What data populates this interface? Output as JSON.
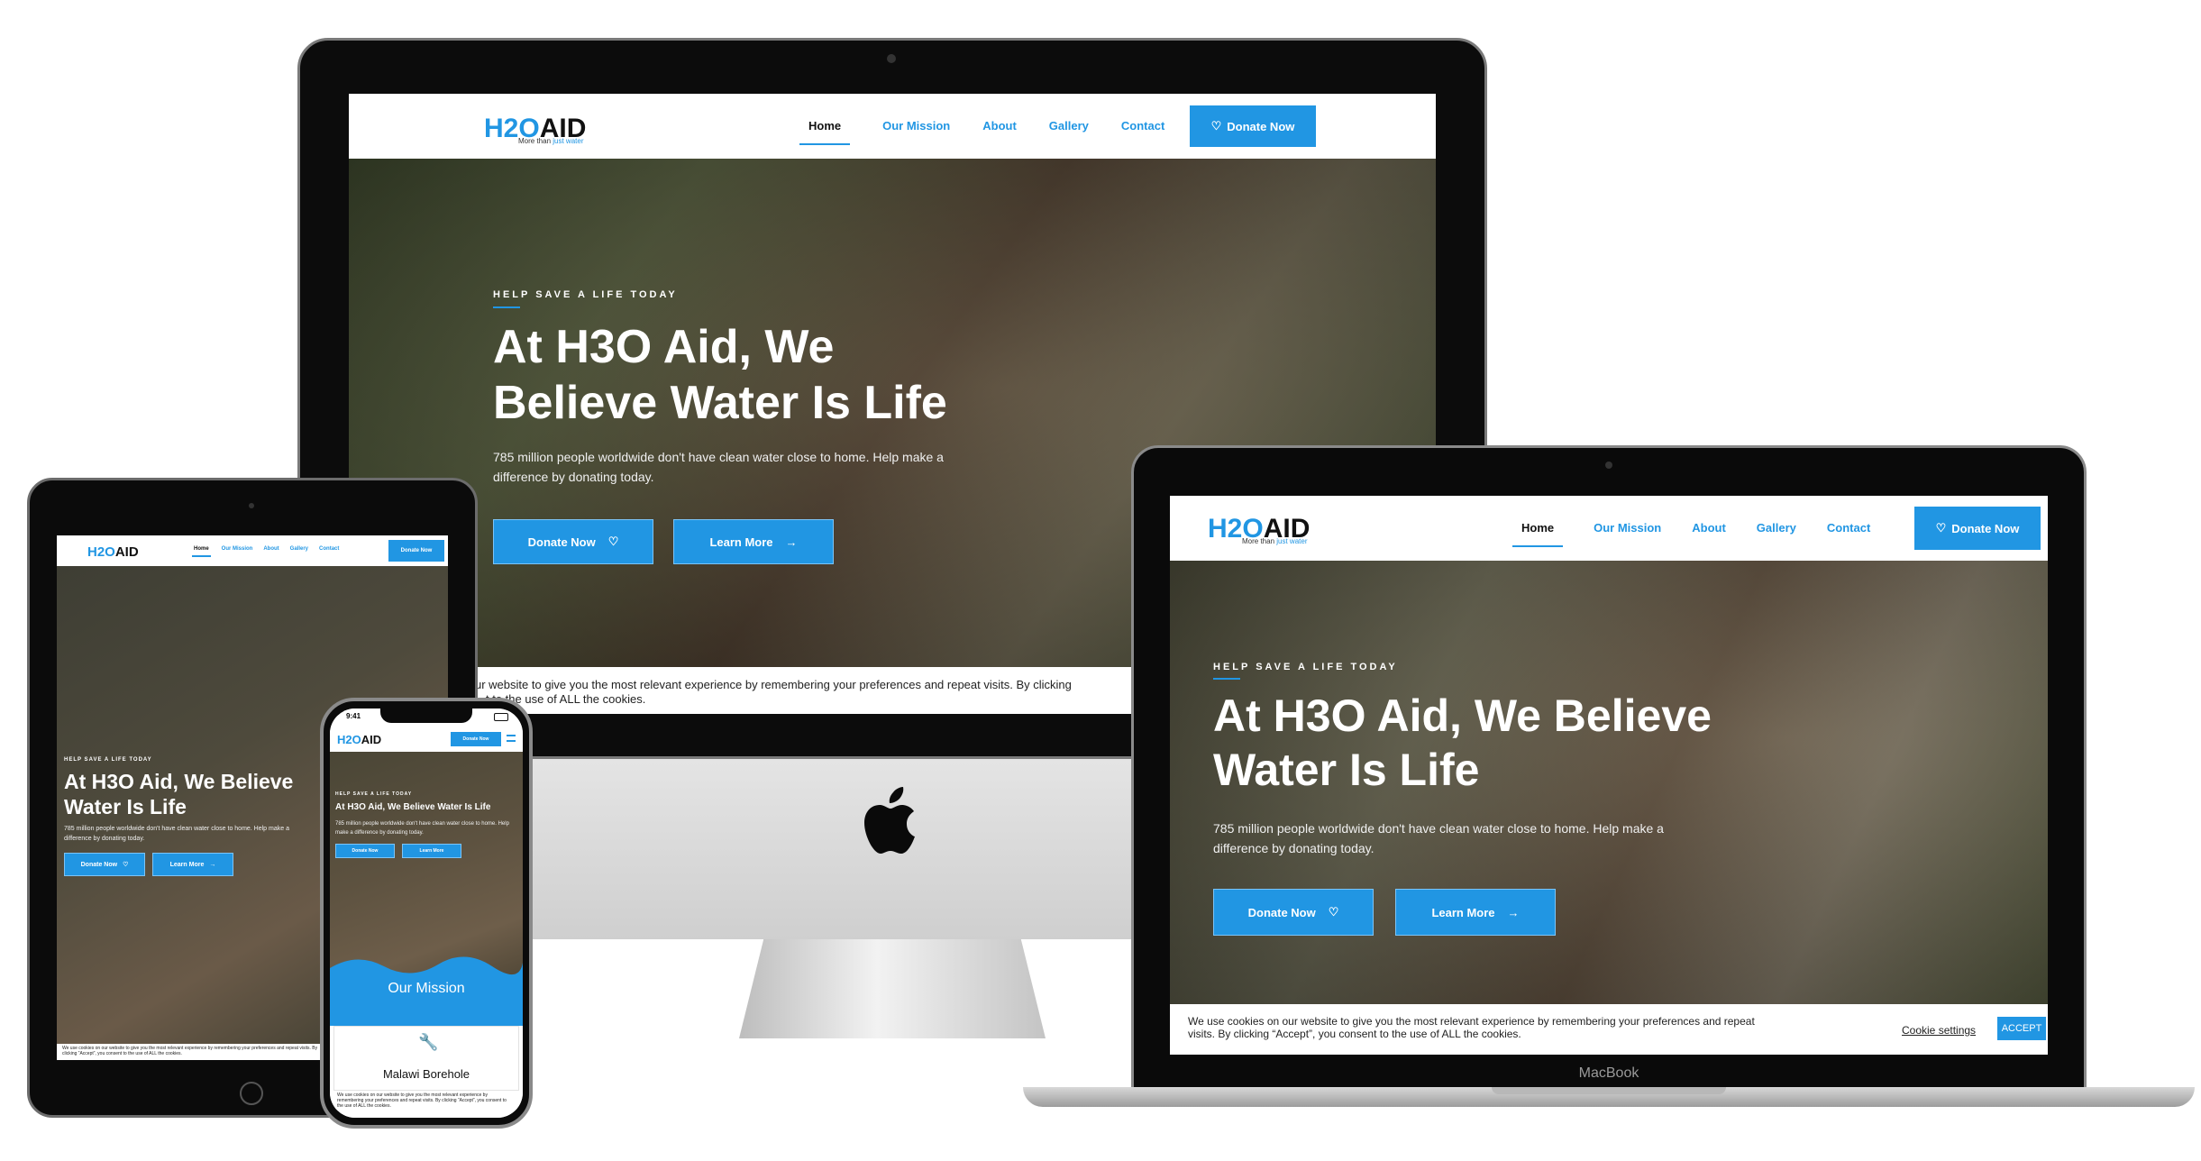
{
  "brand": {
    "logo_h2o": "H2O",
    "logo_aid": "AID",
    "tagline_prefix": "More than ",
    "tagline_accent": "just water"
  },
  "nav": {
    "home": "Home",
    "mission": "Our Mission",
    "about": "About",
    "gallery": "Gallery",
    "contact": "Contact",
    "donate": "Donate Now"
  },
  "hero": {
    "eyebrow": "HELP SAVE A LIFE TODAY",
    "headline": "At H3O Aid, We Believe Water Is Life",
    "subtext": "785 million people worldwide don't have clean water close to home. Help make a difference by donating today.",
    "donate": "Donate Now",
    "learn": "Learn More"
  },
  "cookie": {
    "text": "We use cookies on our website to give you the most relevant experience by remembering your preferences and repeat visits. By clicking “Accept”, you consent to the use of ALL the cookies.",
    "imac_text": "ur website to give you the most relevant experience by remembering your preferences and repeat visits. By clicking",
    "imac_text2": "t to the use of ALL the cookies.",
    "settings": "Cookie settings",
    "accept": "ACCEPT"
  },
  "laptop": {
    "brand": "MacBook"
  },
  "phone": {
    "time": "9:41",
    "hero_headline": "At H3O Aid, We Believe Water Is Life",
    "mission_title": "Our Mission",
    "project_title": "Malawi Borehole",
    "cookie_text": "We use cookies on our website to give you the most relevant experience by remembering your preferences and repeat visits. By clicking “Accept”, you consent to the use of ALL the cookies."
  },
  "colors": {
    "accent": "#2196e3",
    "device_frame": "#111111"
  }
}
